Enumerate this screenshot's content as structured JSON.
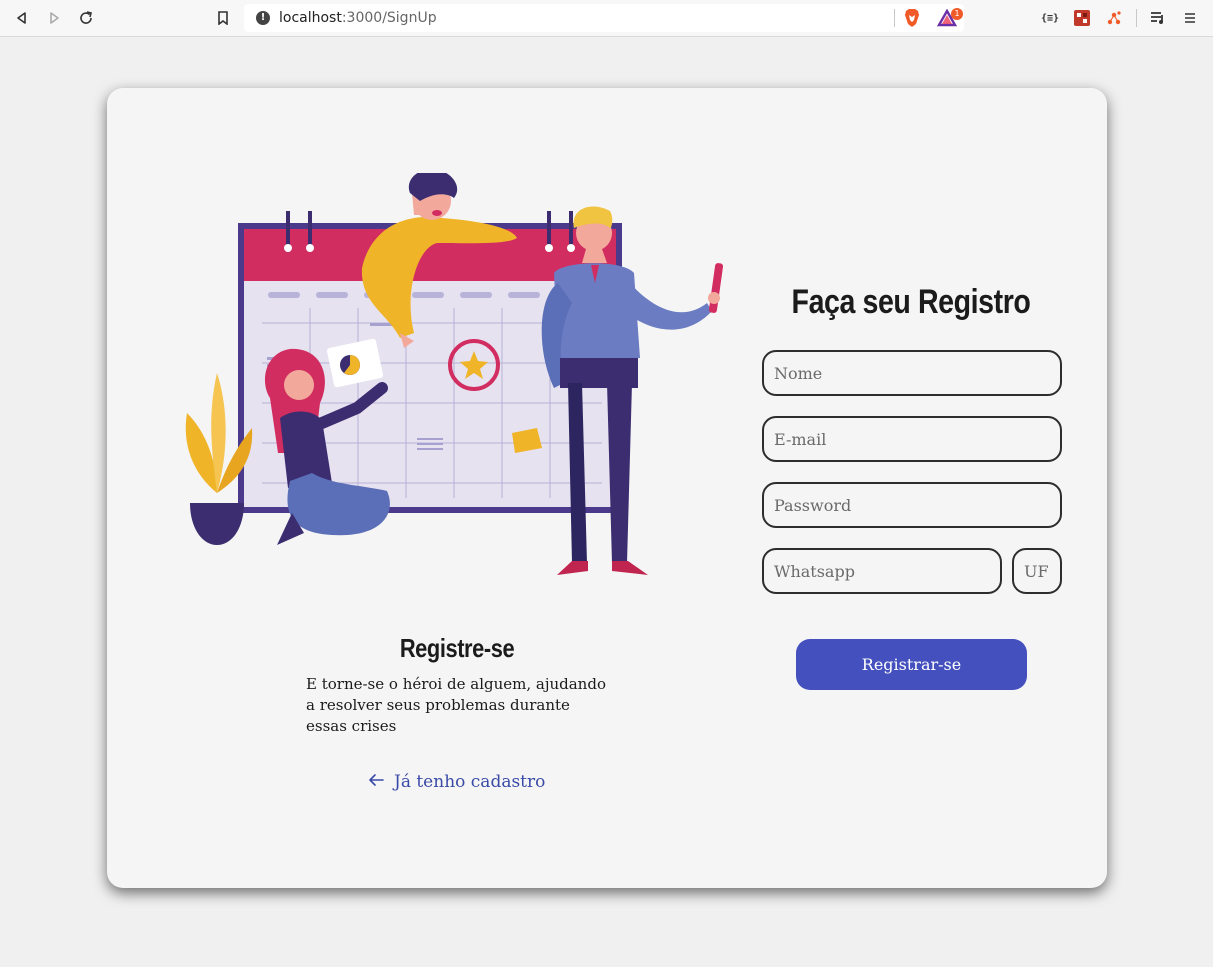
{
  "browser": {
    "url_host": "localhost",
    "url_path": ":3000/SignUp",
    "notification_count": "1"
  },
  "hero": {
    "title": "Registre-se",
    "description": "E torne-se o héroi de alguem, ajudando a resolver seus problemas durante essas crises",
    "back_link": "Já tenho cadastro"
  },
  "form": {
    "title": "Faça seu Registro",
    "name_placeholder": "Nome",
    "email_placeholder": "E-mail",
    "password_placeholder": "Password",
    "whatsapp_placeholder": "Whatsapp",
    "uf_placeholder": "UF",
    "submit_label": "Registrar-se"
  },
  "colors": {
    "accent": "#4450bd",
    "link": "#3a4aa8",
    "calendar_header": "#d22d60",
    "calendar_frame": "#4b3a8c"
  }
}
